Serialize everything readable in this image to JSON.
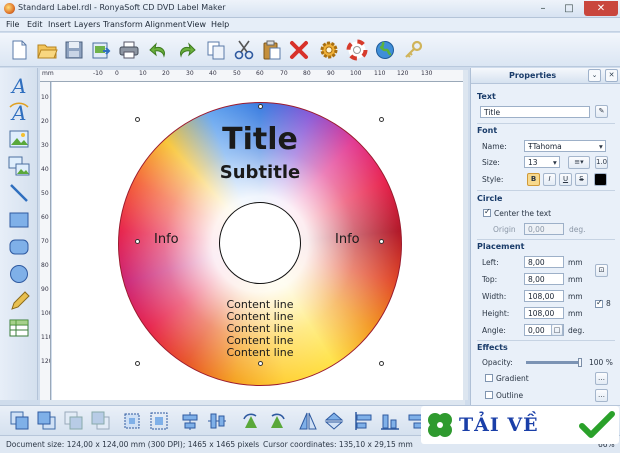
{
  "window": {
    "title": "Standard Label.rdl - RonyaSoft CD DVD Label Maker",
    "controls": [
      "minimize",
      "maximize",
      "close"
    ]
  },
  "menu": {
    "items": [
      "File",
      "Edit",
      "Insert",
      "Layers",
      "Transform",
      "Alignment",
      "View",
      "Help"
    ]
  },
  "toolbar": {
    "icons": [
      "new-icon",
      "open-icon",
      "save-icon",
      "export-icon",
      "print-icon",
      "undo-icon",
      "redo-icon",
      "copy-icon",
      "cut-icon",
      "paste-icon",
      "delete-icon",
      "settings-icon",
      "help-icon",
      "web-icon",
      "key-icon"
    ]
  },
  "left_tools": [
    "text-icon",
    "curved-text-icon",
    "image-icon",
    "image-list-icon",
    "line-icon",
    "rectangle-icon",
    "rounded-rectangle-icon",
    "ellipse-icon",
    "pen-icon",
    "table-icon"
  ],
  "ruler": {
    "unit": "mm",
    "top_labels": [
      "-10",
      "0",
      "10",
      "20",
      "30",
      "40",
      "50",
      "60",
      "70",
      "80",
      "90",
      "100",
      "110",
      "120",
      "130"
    ],
    "left_labels": [
      "10",
      "20",
      "30",
      "40",
      "50",
      "60",
      "70",
      "80",
      "90",
      "100",
      "110",
      "120"
    ]
  },
  "label": {
    "title": "Title",
    "subtitle": "Subtitle",
    "info_left": "Info",
    "info_right": "Info",
    "content_lines": [
      "Content line",
      "Content line",
      "Content line",
      "Content line",
      "Content line"
    ]
  },
  "properties": {
    "header": "Properties",
    "text_section": "Text",
    "text_value": "Title",
    "font_section": "Font",
    "name_label": "Name:",
    "font_name": "Tahoma",
    "size_label": "Size:",
    "size_value": "13",
    "style_label": "Style:",
    "style_buttons": [
      "B",
      "I",
      "U",
      "S"
    ],
    "circle_section": "Circle",
    "center_text_label": "Center the text",
    "origin_label": "Origin",
    "origin_value": "0,00",
    "origin_unit": "deg.",
    "placement_section": "Placement",
    "left_label": "Left:",
    "left_value": "8,00",
    "top_label": "Top:",
    "top_value": "8,00",
    "width_label": "Width:",
    "width_value": "108,00",
    "height_label": "Height:",
    "height_value": "108,00",
    "angle_label": "Angle:",
    "angle_value": "0,00",
    "unit_mm": "mm",
    "unit_deg": "deg.",
    "effects_section": "Effects",
    "opacity_label": "Opacity:",
    "opacity_value": "100 %",
    "opacity_level": 1.0,
    "gradient_label": "Gradient",
    "outline_label": "Outline"
  },
  "bottom_tools": [
    "bring-front-icon",
    "send-back-icon",
    "bring-forward-icon",
    "send-backward-icon",
    "fit-selection-icon",
    "fit-page-icon",
    "center-horizontal-icon",
    "center-vertical-icon",
    "rotate-left-icon",
    "rotate-right-icon",
    "flip-horizontal-icon",
    "flip-vertical-icon",
    "align-left-icon",
    "align-center-icon",
    "align-right-icon"
  ],
  "status": {
    "document_size": "Document size: 124,00 x 124,00 mm (300 DPI); 1465 x 1465 pixels",
    "cursor": "Cursor coordinates: 135,10 x 29,15 mm",
    "zoom": "66%"
  },
  "watermark": {
    "text": "TẢI VỀ"
  },
  "colors": {
    "accent": "#1a3c6a",
    "disc_red": "#e8254f",
    "disc_yellow": "#ffe34a",
    "disc_blue": "#3a7de0",
    "watermark_blue": "#1a3fa8",
    "checkmark_green": "#2aa12a"
  }
}
